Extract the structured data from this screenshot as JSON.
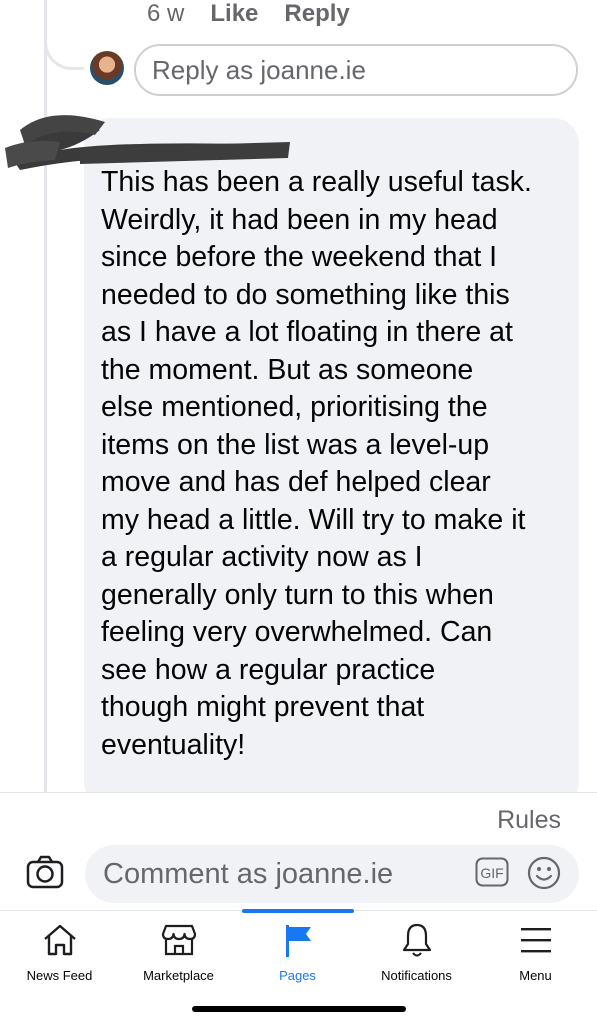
{
  "reply_meta": {
    "age": "6 w",
    "like_label": "Like",
    "reply_label": "Reply"
  },
  "reply_box": {
    "placeholder": "Reply as joanne.ie"
  },
  "comment": {
    "lines": [
      "This has been a really useful task.",
      "Weirdly, it had been in my head",
      "since before the weekend that I",
      "needed to do something like this",
      "as I have a lot floating in there at",
      "the moment. But as someone",
      "else mentioned, prioritising the",
      "items on the list was a level-up",
      "move and has def helped clear",
      "my head a little. Will try to make it",
      "a regular activity now as I",
      "generally only turn to this when",
      "feeling very overwhelmed. Can",
      "see how a regular practice",
      "though might prevent that",
      "eventuality!"
    ]
  },
  "rules_label": "Rules",
  "composer": {
    "placeholder": "Comment as joanne.ie",
    "gif_label": "GIF"
  },
  "tabs": [
    {
      "label": "News Feed",
      "icon": "home-icon",
      "active": false
    },
    {
      "label": "Marketplace",
      "icon": "marketplace-icon",
      "active": false
    },
    {
      "label": "Pages",
      "icon": "flag-icon",
      "active": true
    },
    {
      "label": "Notifications",
      "icon": "bell-icon",
      "active": false
    },
    {
      "label": "Menu",
      "icon": "menu-icon",
      "active": false
    }
  ],
  "colors": {
    "accent": "#1877f2",
    "bubble": "#f0f2f5",
    "secondary_text": "#65676b"
  }
}
